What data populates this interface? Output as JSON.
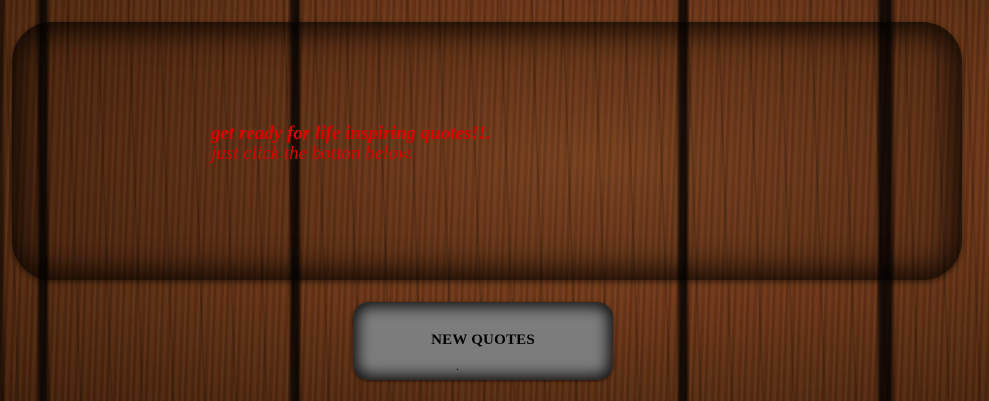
{
  "quote_panel": {
    "line1": "get ready for life inspiring quotes!!.",
    "line2": "just click the botton below."
  },
  "button": {
    "label": "NEW QUOTES",
    "dot": "."
  },
  "colors": {
    "quote_text": "#e00000",
    "button_bg": "#7c7c7c",
    "wood_base": "#6b3618"
  }
}
